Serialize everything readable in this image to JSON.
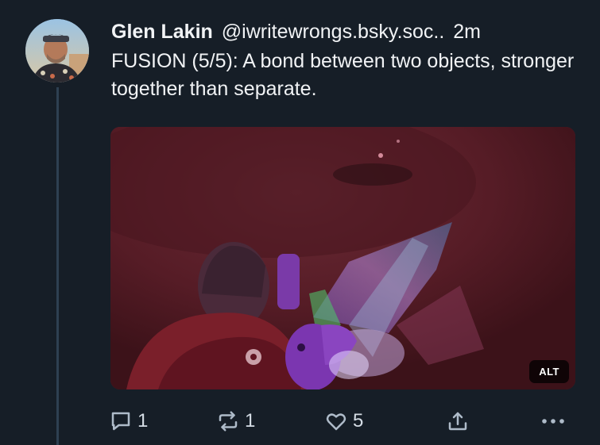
{
  "post": {
    "author_name": "Glen Lakin",
    "handle": "@iwritewrongs.bsky.soc..",
    "time": "2m",
    "text": "FUSION (5/5):  A bond between two objects, stronger together than separate.",
    "media": {
      "alt_badge": "ALT"
    }
  },
  "actions": {
    "reply_count": "1",
    "repost_count": "1",
    "like_count": "5"
  },
  "colors": {
    "background": "#161e27",
    "thread_line": "#2e4052",
    "icon": "#aebbc9",
    "text": "#f1f3f5"
  },
  "icons": [
    "reply-icon",
    "repost-icon",
    "like-icon",
    "share-icon",
    "more-options-icon"
  ]
}
